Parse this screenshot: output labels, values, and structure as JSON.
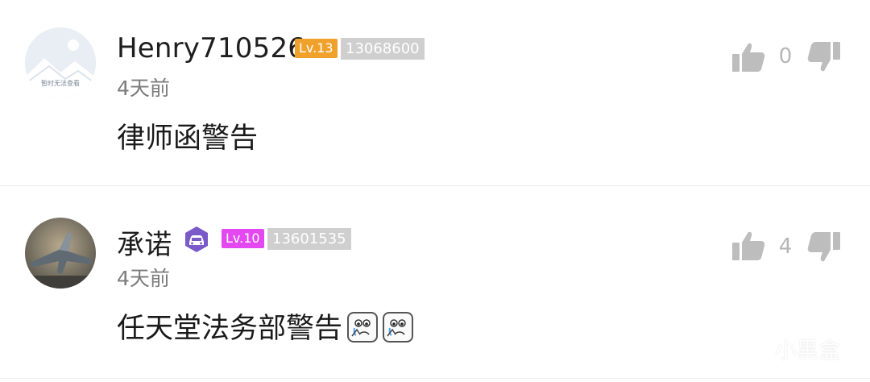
{
  "comments": [
    {
      "username": "Henry710526",
      "level": "Lv.13",
      "level_color": "#f0a12b",
      "user_id": "13068600",
      "time": "4天前",
      "content": "律师函警告",
      "like_count": "0",
      "avatar_placeholder_text": "暂时无法查看"
    },
    {
      "username": "承诺",
      "level": "Lv.10",
      "level_color": "#e448f0",
      "user_id": "13601535",
      "time": "4天前",
      "content": "任天堂法务部警告",
      "like_count": "4"
    }
  ],
  "watermark": "小黑盒",
  "icons": {
    "like": "thumbs-up-icon",
    "dislike": "thumbs-down-icon",
    "vip": "car-badge-icon",
    "emoji": "crying-emoji-icon"
  }
}
